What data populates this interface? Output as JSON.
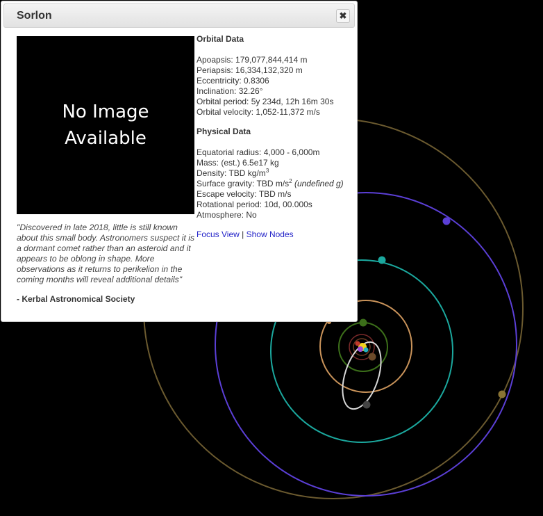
{
  "dialog": {
    "title": "Sorlon",
    "close_symbol": "✖",
    "image_placeholder": "No Image Available",
    "description": "\"Discovered in late 2018, little is still known about this small body. Astronomers suspect it is a dormant comet rather than an asteroid and it appears to be oblong in shape. More observations as it returns to perikelion in the coming months will reveal additional details\"",
    "source": "- Kerbal Astronomical Society",
    "orbital": {
      "title": "Orbital Data",
      "apoapsis": "Apoapsis: 179,077,844,414 m",
      "periapsis": "Periapsis: 16,334,132,320 m",
      "eccentricity": "Eccentricity: 0.8306",
      "inclination": "Inclination: 32.26°",
      "period": "Orbital period: 5y 234d, 12h 16m 30s",
      "velocity": "Orbital velocity: 1,052-11,372 m/s"
    },
    "physical": {
      "title": "Physical Data",
      "radius": "Equatorial radius: 4,000 - 6,000m",
      "mass": "Mass: (est.) 6.5e17 kg",
      "density": "Density: TBD kg/m",
      "density_exp": "3",
      "gravity": "Surface gravity: TBD m/s",
      "gravity_exp": "2",
      "gravity_note": "(undefined g)",
      "escape": "Escape velocity: TBD m/s",
      "rotation": "Rotational period: 10d, 00.000s",
      "atmosphere": "Atmosphere: No"
    },
    "links": {
      "focus": "Focus View",
      "separator": " | ",
      "nodes": "Show Nodes"
    }
  },
  "colors": {
    "outer_orbit": "#6b5a2f",
    "blue_orbit": "#5b3fd6",
    "teal_orbit": "#1ba89e",
    "tan_orbit": "#c9935a",
    "green_orbit": "#3c6f1a",
    "comet_orbit": "#d8d8d8"
  }
}
